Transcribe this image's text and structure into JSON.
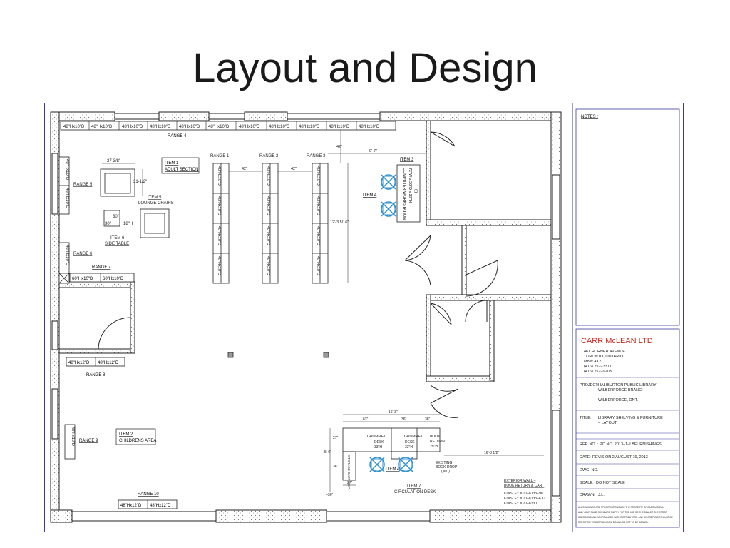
{
  "slide": {
    "title": "Layout and Design"
  },
  "shelf_labels": {
    "top": [
      "48\"Hx10\"D",
      "48\"Hx10\"D",
      "48\"Hx10\"D",
      "48\"Hx10\"D",
      "48\"Hx10\"D",
      "48\"Hx10\"D",
      "48\"Hx10\"D",
      "48\"Hx10\"D",
      "48\"Hx10\"D",
      "48\"Hx10\"D",
      "48\"Hx10\"D"
    ],
    "range7": [
      "60\"Hx10\"D",
      "60\"Hx10\"D"
    ],
    "range8": [
      "48\"Hx12\"D",
      "48\"Hx12\"D"
    ],
    "range10": [
      "48\"Hx12\"D",
      "48\"Hx12\"D"
    ],
    "left_vertical": "48\"Hx10\"D",
    "range_vertical": "48\"Hx10\"D",
    "range9_vertical": "48\"Hx12\"D"
  },
  "ranges": {
    "r1": "RANGE 1",
    "r2": "RANGE 2",
    "r3": "RANGE 3",
    "r4": "RANGE 4",
    "r5": "RANGE 5",
    "r6": "RANGE 6",
    "r7": "RANGE 7",
    "r8": "RANGE 8",
    "r9": "RANGE 9",
    "r10": "RANGE 10"
  },
  "items": {
    "item1_title": "ITEM 1",
    "item1_sub": "ADULT SECTION",
    "item2_title": "ITEM 2",
    "item2_sub": "CHILDRENS AREA",
    "item3": "ITEM 3",
    "item4": "ITEM 4",
    "item5_title": "ITEM 5",
    "item5_sub": "LOUNGE CHAIRS",
    "item6_title": "ITEM 6",
    "item6_sub": "SIDE TABLE",
    "item7_title": "ITEM 7",
    "item7_sub": "CIRCULATION DESK",
    "item4_b": "ITEM 4"
  },
  "dims": {
    "d42a": "42\"",
    "d42b": "42\"",
    "d42c": "42\"",
    "d9_7": "9'-7\"",
    "d12_3": "12'-3 5/16\"",
    "d27": "27-3/8\"",
    "d31": "31-1/2\"",
    "d30": "30\"",
    "d36": "30\"",
    "d18": "18\"H",
    "d16_3": "16'-3\"",
    "d63": "63\"",
    "d36b": "36\"",
    "d36c": "36\"",
    "d5_0": "5'-0\"",
    "d27b": "27\"",
    "d36d": "36\"",
    "d27c": "27\"",
    "d36e": "+36\"",
    "d16_8": "16'-8 1/2\""
  },
  "workstation": {
    "line1": "COMPUTER WORKSTATION",
    "line2": "72\"W x 30\"D x 29\"H",
    "line3": "(I)"
  },
  "desk": {
    "grommet1": "GROMMET",
    "grommet2": "GROMMET",
    "desk1a": "DESK",
    "desk1b": "33\"H",
    "desk2a": "DESK",
    "desk2b": "33\"H",
    "book_return_a": "BOOK",
    "book_return_b": "RETURN",
    "book_return_c": "29\"H",
    "cart": "STORAGE CART (SEP)",
    "book_drop_a": "EXISTING",
    "book_drop_b": "BOOK DROP",
    "book_drop_c": "(NIC)"
  },
  "notes": {
    "exterior_a": "EXTERIOR WALL –",
    "exterior_b": "BOOK RETURN & CART",
    "kinsley1": "KINSLEY # 10–8133–96",
    "kinsley2": "KINSLEY # 10–8133–EXT",
    "kinsley3": "KINSLEY # 20–8330"
  },
  "title_block": {
    "notes_label": "NOTES :",
    "company": "CARR McLEAN LTD",
    "addr1": "461 HORNER AVENUE",
    "addr2": "TORONTO, ONTARIO",
    "addr3": "M8W 4X2",
    "phone1": "(416) 252–3371",
    "phone2": "(416) 252–9203",
    "project_label": "PROJECT:",
    "project_1": "HALIBURTON PUBLIC LIBRARY",
    "project_2": "WILBERFORCE BRANCH",
    "project_3": "WILBERFORCE, ONT.",
    "title_label": "TITLE:",
    "title_1": "LIBRARY SHELVING & FURNITURE",
    "title_2": "– LAYOUT",
    "ref_label": "REF. NO. :",
    "ref_value": "PO NO. 2013–1–LBFURNISHINGS",
    "date_label": "DATE:",
    "date_value": "REVISION 2 AUGUST 19, 2013",
    "dwg_label": "DWG. NO. :",
    "dwg_value": "–",
    "scale_label": "SCALE:",
    "scale_value": "DO NOT SCALE",
    "drawn_label": "DRAWN:",
    "drawn_value": "J.L.",
    "disclaimer_1": "ALL DRAWINGS ARE SPECIFICATIONS ARE THE PROPERTY OF CARR MCLEAN",
    "disclaimer_2": "AND YOUR SAME STANDARD SIMPLY FOR THE JOB SO THE DEALER THE ERROR",
    "disclaimer_3": "CARR MCLEAN HAS ARRANGED WITH DISTRIBUTORS. ANY DISCREPANCIES MUST BE",
    "disclaimer_4": "REPORTED TO CARR MCLEAN. DRAWINGS NOT TO BE SCALED."
  },
  "colors": {
    "sheet_border": "#3a3aa0",
    "chair_blue": "#2d8fd0",
    "title_red": "#c8281e"
  }
}
